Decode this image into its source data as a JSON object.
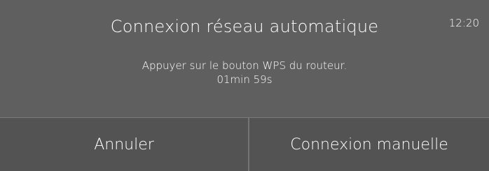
{
  "header": {
    "title": "Connexion réseau automatique",
    "time": "12:20"
  },
  "message": {
    "instruction": "Appuyer sur le bouton WPS du routeur.",
    "countdown": "01min 59s"
  },
  "buttons": {
    "cancel_label": "Annuler",
    "manual_label": "Connexion manuelle"
  }
}
